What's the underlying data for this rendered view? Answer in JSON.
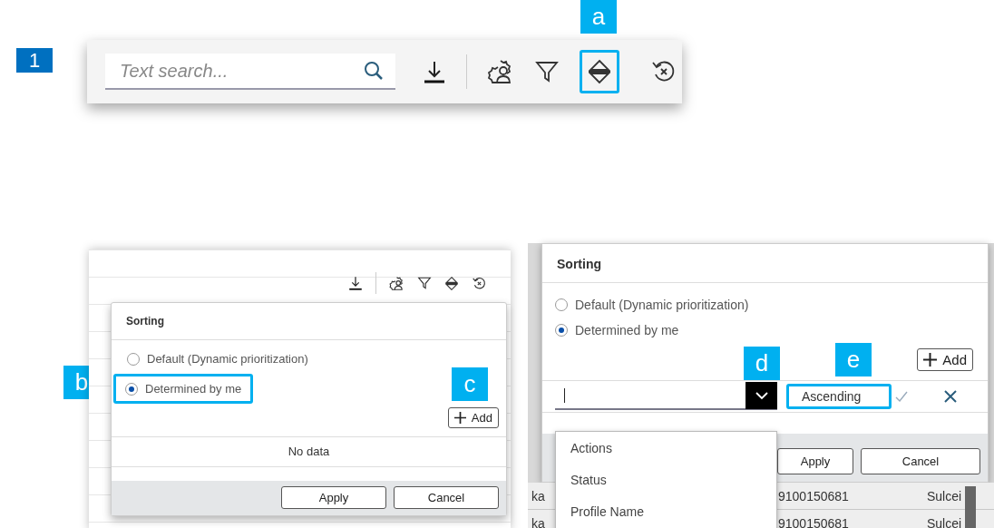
{
  "step_marker": "1",
  "toolbar": {
    "search_placeholder": "Text search...",
    "callout": "a"
  },
  "sorting_popover": {
    "callouts": [
      "b",
      "c"
    ],
    "title": "Sorting",
    "options": [
      {
        "label": "Default (Dynamic prioritization)",
        "selected": false
      },
      {
        "label": "Determined by me",
        "selected": true
      }
    ],
    "add_button": "Add",
    "empty_text": "No data",
    "buttons": [
      "Apply",
      "Cancel"
    ]
  },
  "sorting_dialog": {
    "callouts": [
      "d",
      "e"
    ],
    "title": "Sorting",
    "options": [
      {
        "label": "Default (Dynamic prioritization)",
        "selected": false
      },
      {
        "label": "Determined by me",
        "selected": true
      }
    ],
    "add_button": "Add",
    "sort_direction": "Ascending",
    "field_options": [
      "Actions",
      "Status",
      "Profile Name"
    ],
    "buttons": [
      "Apply",
      "Cancel"
    ],
    "table_rows": [
      [
        "ka",
        "9100150681",
        "Sulcei"
      ],
      [
        "ka",
        "9100150681",
        "Sulcei"
      ]
    ]
  }
}
